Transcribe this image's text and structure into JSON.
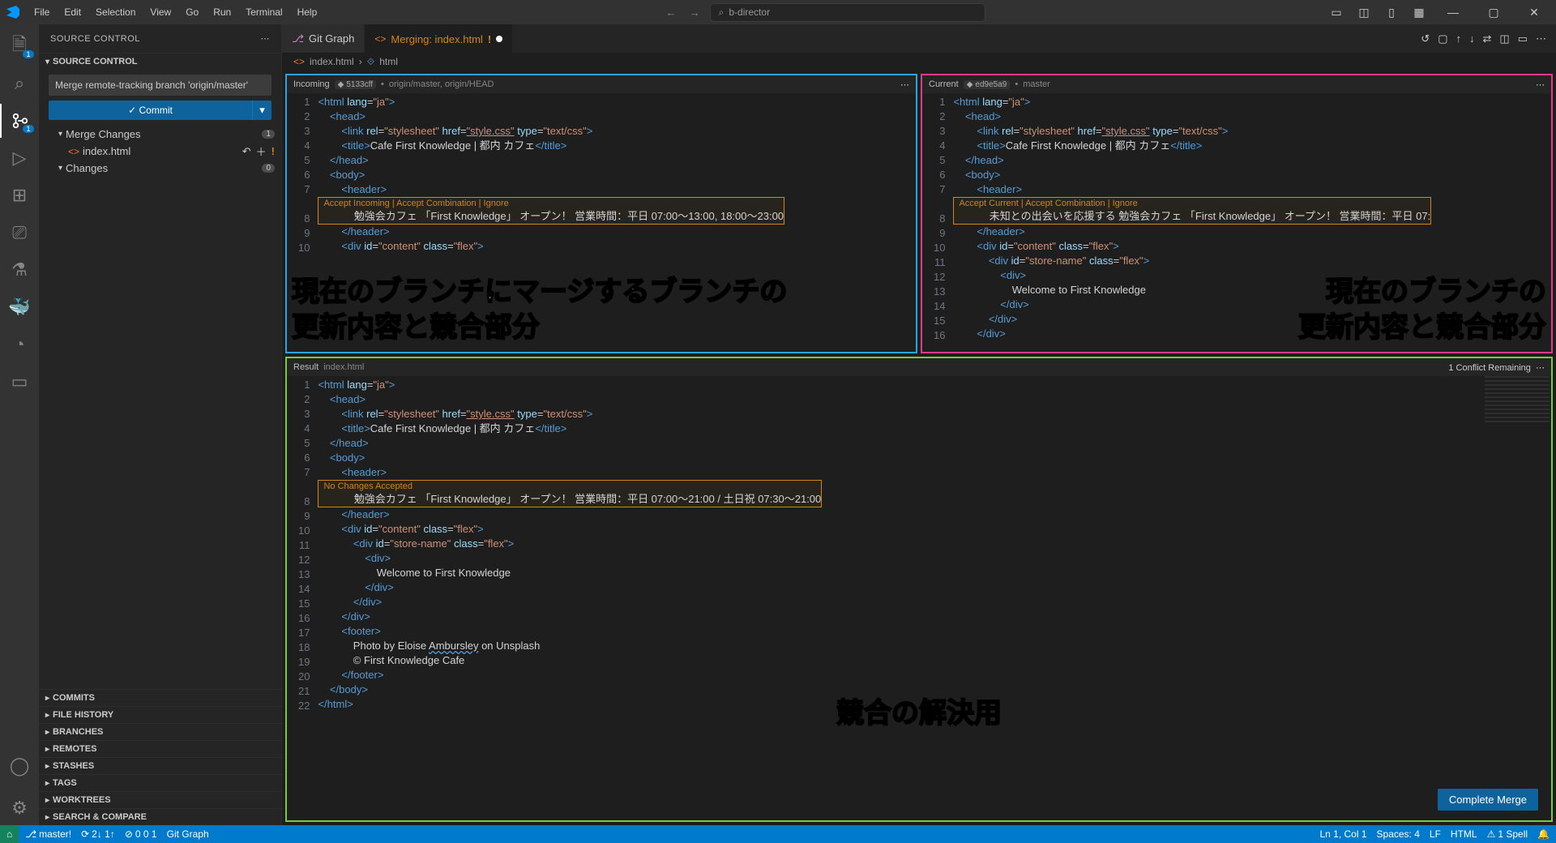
{
  "menu": [
    "File",
    "Edit",
    "Selection",
    "View",
    "Go",
    "Run",
    "Terminal",
    "Help"
  ],
  "search_placeholder": "b-director",
  "activitybar_badges": {
    "explorer": "1",
    "scm": "1"
  },
  "sidebar": {
    "title": "SOURCE CONTROL",
    "provider": "SOURCE CONTROL",
    "commit_message": "Merge remote-tracking branch 'origin/master'",
    "commit_btn": "Commit",
    "merge_changes": "Merge Changes",
    "merge_count": "1",
    "file": "index.html",
    "changes": "Changes",
    "changes_count": "0",
    "bottom_sections": [
      "COMMITS",
      "FILE HISTORY",
      "BRANCHES",
      "REMOTES",
      "STASHES",
      "TAGS",
      "WORKTREES",
      "SEARCH & COMPARE"
    ]
  },
  "tabs": {
    "git_graph": "Git Graph",
    "merge_title": "Merging: index.html"
  },
  "breadcrumb": {
    "file": "index.html",
    "sym": "html"
  },
  "incoming": {
    "title": "Incoming",
    "commit": "5133cff",
    "branch": "origin/master, origin/HEAD",
    "actions": "Accept Incoming | Accept Combination | Ignore",
    "conflict_line": "            勉強会カフェ 「First Knowledge」 オープン！ 営業時間：平日 07:00〜13:00, 18:00〜23:00",
    "overlay_l1": "現在のブランチにマージするブランチの",
    "overlay_l2": "更新内容と競合部分"
  },
  "current": {
    "title": "Current",
    "commit": "ed9e5a9",
    "branch": "master",
    "actions": "Accept Current | Accept Combination | Ignore",
    "conflict_line": "            未知との出会いを応援する 勉強会カフェ 「First Knowledge」 オープン！ 営業時間：平日 07:",
    "overlay_l1": "現在のブランチの",
    "overlay_l2": "更新内容と競合部分"
  },
  "result": {
    "title": "Result",
    "file": "index.html",
    "conflict_remaining": "1 Conflict Remaining",
    "actions": "No Changes Accepted",
    "conflict_line": "            勉強会カフェ 「First Knowledge」 オープン！ 営業時間：平日 07:00〜21:00 / 土日祝 07:30〜21:00",
    "overlay": "競合の解決用",
    "complete_btn": "Complete Merge"
  },
  "code_common": {
    "html_open": "<html lang=\"ja\">",
    "head_open": "    <head>",
    "link": "        <link rel=\"stylesheet\" href=\"style.css\" type=\"text/css\">",
    "title": "        <title>Cafe First Knowledge | 都内 カフェ</title>",
    "head_close": "    </head>",
    "body_open": "    <body>",
    "header_open": "        <header>",
    "header_close": "        </header>",
    "content_div": "        <div id=\"content\" class=\"flex\">",
    "store_div": "            <div id=\"store-name\" class=\"flex\">",
    "inner_div_open": "                <div>",
    "welcome": "                    Welcome to First Knowledge",
    "inner_div_close": "                </div>",
    "store_close": "            </div>",
    "content_close": "        </div>",
    "footer_open": "        <footer>",
    "photo_credit": "            Photo by Eloise Ambursley on Unsplash",
    "copyright": "            © First Knowledge Cafe",
    "footer_close": "        </footer>",
    "body_close": "    </body>",
    "html_close": "</html>"
  },
  "statusbar": {
    "branch": "master!",
    "sync": "2↓ 1↑",
    "problems": "0  0  1",
    "git_graph": "Git Graph",
    "cursor": "Ln 1, Col 1",
    "spaces": "Spaces: 4",
    "encoding": "LF",
    "lang": "HTML",
    "spell": "1 Spell"
  }
}
